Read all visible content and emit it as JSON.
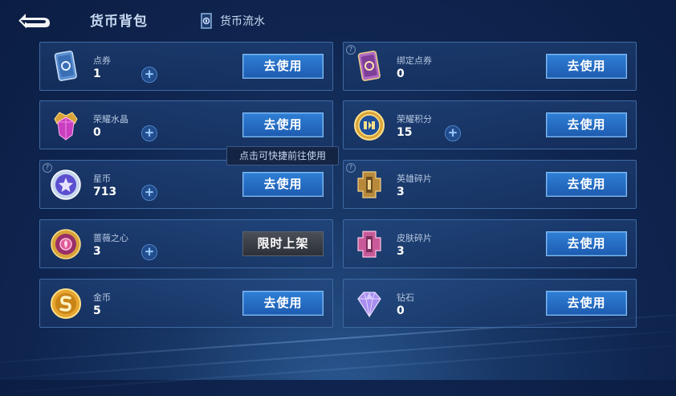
{
  "header": {
    "title": "货币背包",
    "flow_label": "货币流水"
  },
  "cards": [
    {
      "name": "点券",
      "count": "1",
      "has_plus": true,
      "action": "去使用",
      "icon": "coupon-card-icon"
    },
    {
      "name": "绑定点券",
      "count": "0",
      "has_plus": false,
      "action": "去使用",
      "icon": "bound-coupon-card-icon"
    },
    {
      "name": "荣耀水晶",
      "count": "0",
      "has_plus": true,
      "action": "去使用",
      "icon": "glory-crystal-icon"
    },
    {
      "name": "荣耀积分",
      "count": "15",
      "has_plus": true,
      "action": "去使用",
      "icon": "glory-points-icon"
    },
    {
      "name": "星币",
      "count": "713",
      "has_plus": true,
      "action": "去使用",
      "icon": "star-coin-icon"
    },
    {
      "name": "英雄碎片",
      "count": "3",
      "has_plus": false,
      "action": "去使用",
      "icon": "hero-fragment-icon"
    },
    {
      "name": "蔷薇之心",
      "count": "3",
      "has_plus": true,
      "action": "限时上架",
      "icon": "rose-heart-icon"
    },
    {
      "name": "皮肤碎片",
      "count": "3",
      "has_plus": false,
      "action": "去使用",
      "icon": "skin-fragment-icon"
    },
    {
      "name": "金币",
      "count": "5",
      "has_plus": false,
      "action": "去使用",
      "icon": "gold-coin-icon"
    },
    {
      "name": "钻石",
      "count": "0",
      "has_plus": false,
      "action": "去使用",
      "icon": "diamond-icon"
    }
  ],
  "tooltip": "点击可快捷前往使用"
}
